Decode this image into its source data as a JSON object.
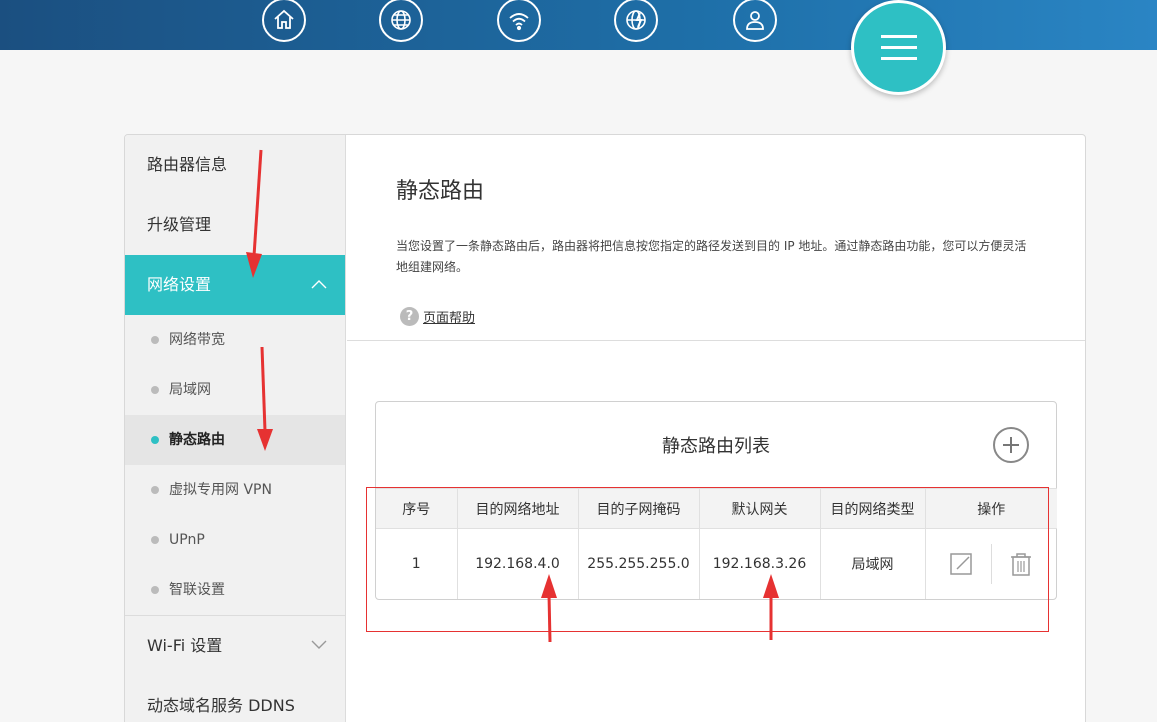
{
  "nav": {
    "icons": [
      "home-icon",
      "globe-icon",
      "wifi-icon",
      "globe-lightning-icon",
      "user-icon"
    ],
    "menu_icon": "hamburger-menu-icon"
  },
  "sidebar": {
    "items_top": [
      {
        "label": "路由器信息"
      },
      {
        "label": "升级管理"
      }
    ],
    "network_settings": {
      "label": "网络设置",
      "expanded": true
    },
    "sub_items": [
      {
        "label": "网络带宽"
      },
      {
        "label": "局域网"
      },
      {
        "label": "静态路由",
        "selected": true
      },
      {
        "label": "虚拟专用网 VPN"
      },
      {
        "label": "UPnP"
      },
      {
        "label": "智联设置"
      }
    ],
    "items_bottom": [
      {
        "label": "Wi-Fi 设置"
      },
      {
        "label": "动态域名服务 DDNS"
      }
    ]
  },
  "content": {
    "title": "静态路由",
    "description": "当您设置了一条静态路由后，路由器将把信息按您指定的路径发送到目的 IP 地址。通过静态路由功能，您可以方便灵活地组建网络。",
    "help_label": "页面帮助"
  },
  "route_list": {
    "title": "静态路由列表",
    "columns": [
      "序号",
      "目的网络地址",
      "目的子网掩码",
      "默认网关",
      "目的网络类型",
      "操作"
    ],
    "rows": [
      {
        "index": "1",
        "dest_ip": "192.168.4.0",
        "subnet_mask": "255.255.255.0",
        "gateway": "192.168.3.26",
        "net_type": "局域网"
      }
    ]
  },
  "colors": {
    "accent": "#2ec0c4",
    "topbar": "#1e6fa8",
    "annotation": "#e63232"
  }
}
